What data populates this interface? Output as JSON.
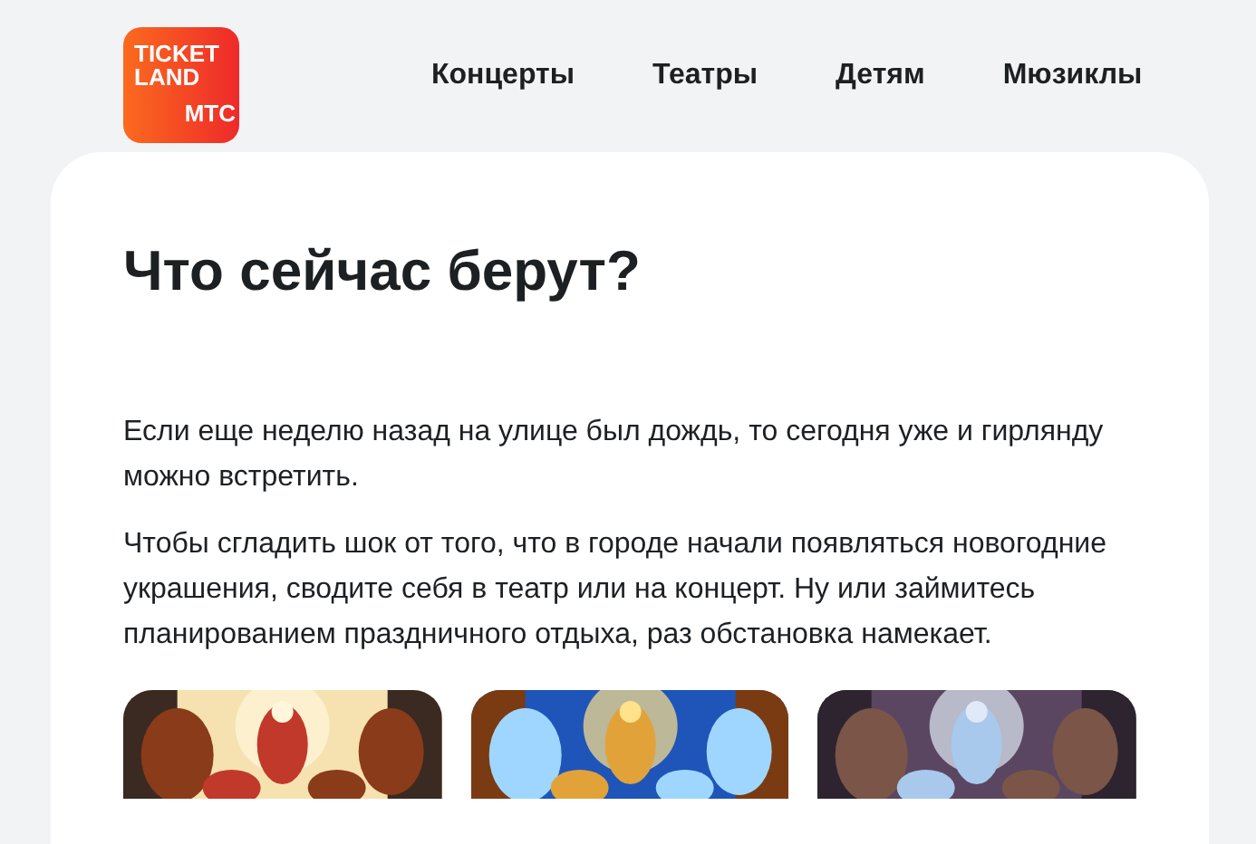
{
  "logo": {
    "lines": [
      "TICKET",
      "LAND"
    ],
    "brand": "МТС"
  },
  "nav": [
    {
      "label": "Концерты"
    },
    {
      "label": "Театры"
    },
    {
      "label": "Детям"
    },
    {
      "label": "Мюзиклы"
    }
  ],
  "article": {
    "title": "Что сейчас берут?",
    "paragraphs": [
      "Если еще неделю назад на улице был дождь, то сегодня уже и гирлянду можно встретить.",
      "Чтобы сгладить шок от того, что в городе начали появляться новогодние украшения, сводите себя в театр или на концерт. Ну или займитесь планированием праздничного отдыха, раз обстановка намекает."
    ],
    "cards": [
      {
        "kind": "picture"
      },
      {
        "kind": "picture"
      },
      {
        "kind": "picture"
      }
    ]
  }
}
